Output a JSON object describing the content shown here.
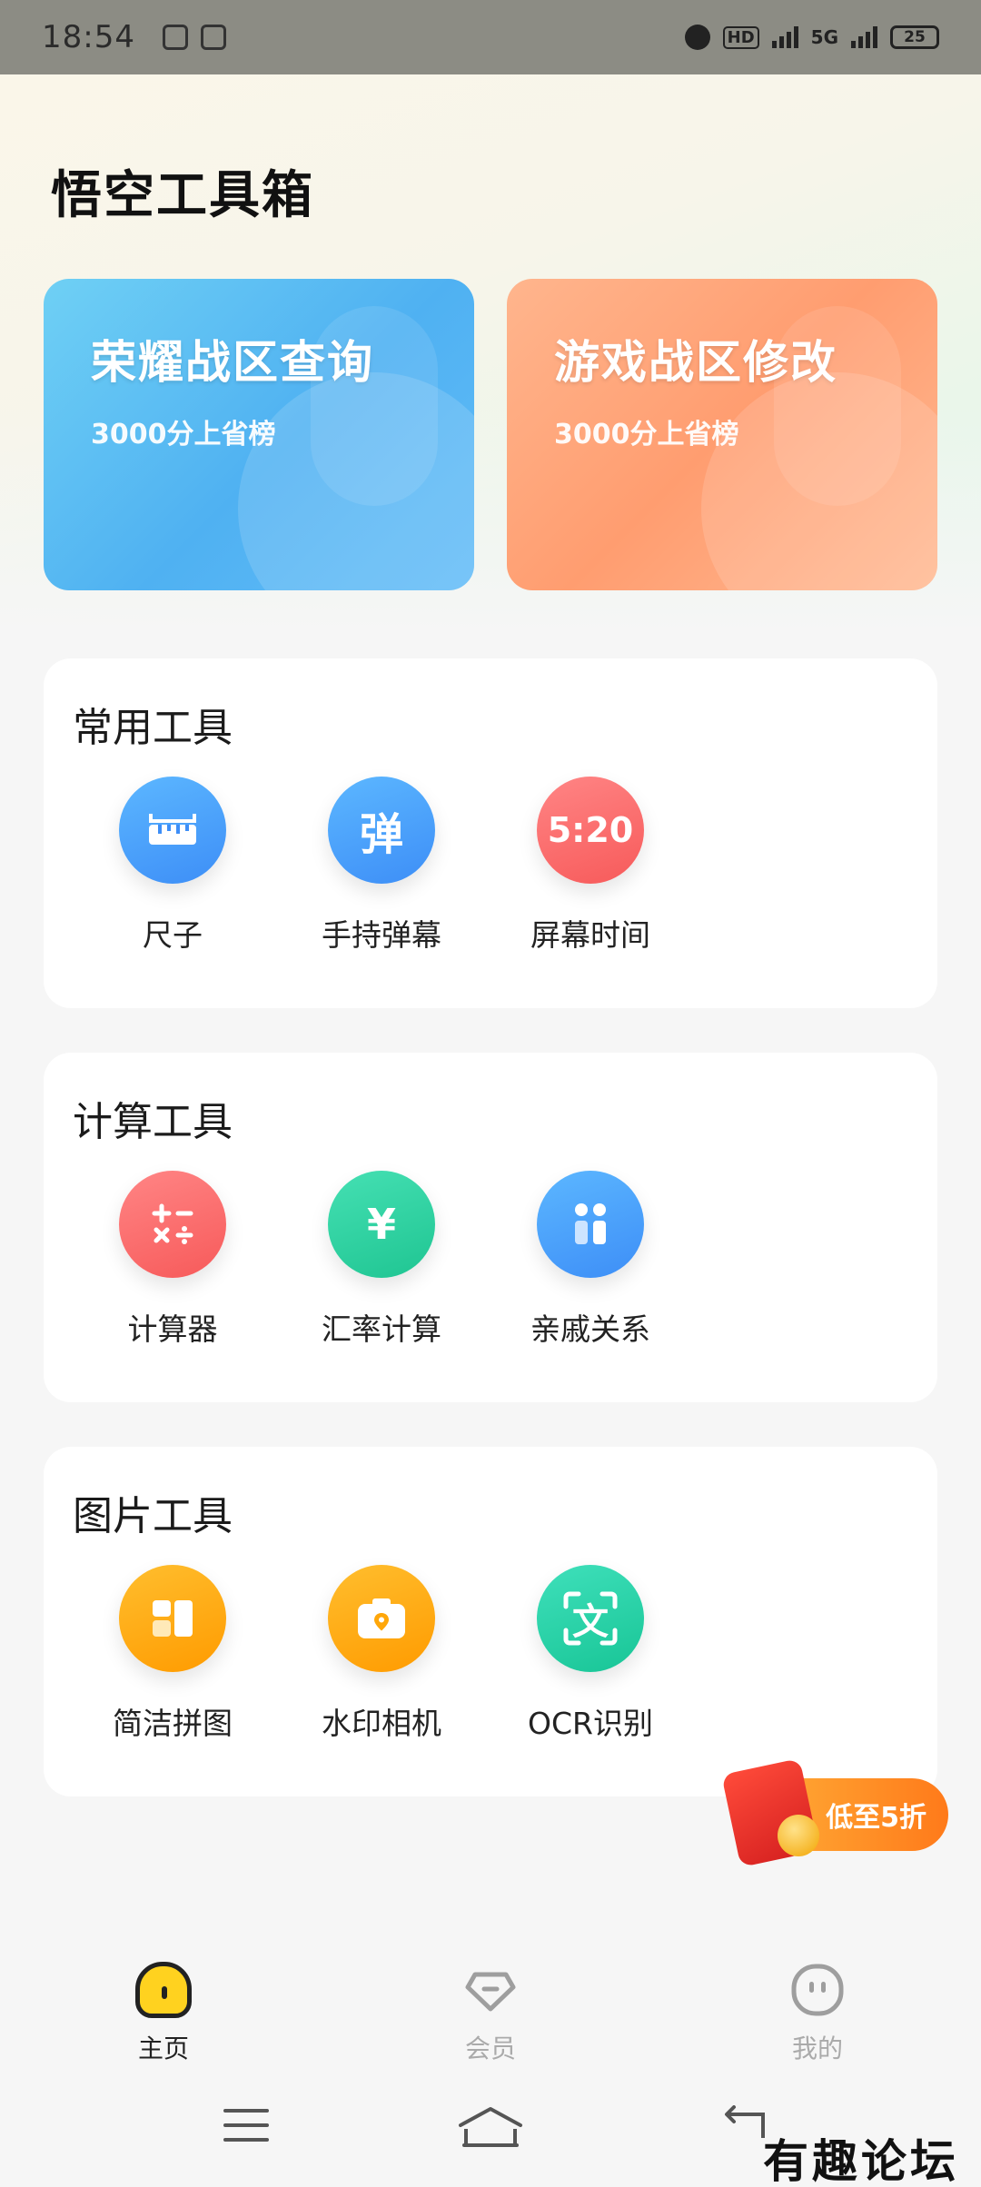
{
  "status_bar": {
    "time": "18:54",
    "network": "5G",
    "hd_label": "HD",
    "battery": "25"
  },
  "app_title": "悟空工具箱",
  "banners": [
    {
      "title": "荣耀战区查询",
      "subtitle": "3000分上省榜",
      "color": "#4fb1f2"
    },
    {
      "title": "游戏战区修改",
      "subtitle": "3000分上省榜",
      "color": "#ff9d70"
    }
  ],
  "sections": [
    {
      "title": "常用工具",
      "tools": [
        {
          "label": "尺子",
          "icon": "ruler-icon"
        },
        {
          "label": "手持弹幕",
          "icon": "barrage-icon",
          "glyph": "弹"
        },
        {
          "label": "屏幕时间",
          "icon": "screen-time-icon",
          "glyph": "5:20"
        }
      ]
    },
    {
      "title": "计算工具",
      "tools": [
        {
          "label": "计算器",
          "icon": "calculator-icon"
        },
        {
          "label": "汇率计算",
          "icon": "exchange-rate-icon",
          "glyph": "¥"
        },
        {
          "label": "亲戚关系",
          "icon": "relatives-icon"
        }
      ]
    },
    {
      "title": "图片工具",
      "tools": [
        {
          "label": "简洁拼图",
          "icon": "collage-icon"
        },
        {
          "label": "水印相机",
          "icon": "watermark-camera-icon"
        },
        {
          "label": "OCR识别",
          "icon": "ocr-icon",
          "glyph": "文"
        }
      ]
    }
  ],
  "promo": {
    "label": "低至5折"
  },
  "bottom_nav": [
    {
      "label": "主页",
      "icon": "home-icon",
      "active": true
    },
    {
      "label": "会员",
      "icon": "diamond-icon",
      "active": false
    },
    {
      "label": "我的",
      "icon": "profile-icon",
      "active": false
    }
  ],
  "watermark": "有趣论坛"
}
